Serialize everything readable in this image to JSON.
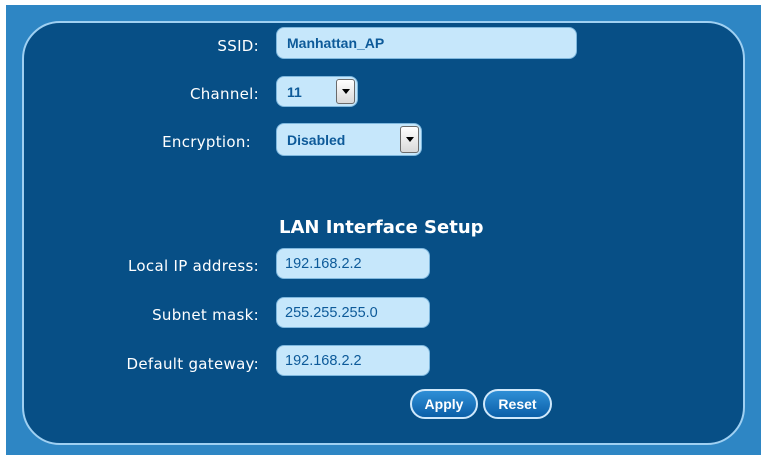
{
  "wireless": {
    "ssid": {
      "label": "SSID:",
      "value": "Manhattan_AP"
    },
    "channel": {
      "label": "Channel:",
      "value": "11"
    },
    "encryption": {
      "label": "Encryption:",
      "value": "Disabled"
    }
  },
  "lan": {
    "title": "LAN Interface Setup",
    "local_ip": {
      "label": "Local IP address:",
      "value": "192.168.2.2"
    },
    "subnet_mask": {
      "label": "Subnet mask:",
      "value": "255.255.255.0"
    },
    "default_gateway": {
      "label": "Default gateway:",
      "value": "192.168.2.2"
    }
  },
  "buttons": {
    "apply": "Apply",
    "reset": "Reset"
  },
  "colors": {
    "panel": "#074f86",
    "frame": "#2e86c4",
    "field": "#c6e7fb",
    "field_text": "#0d5a99"
  },
  "icons": {
    "dropdown": "chevron-down-icon"
  }
}
